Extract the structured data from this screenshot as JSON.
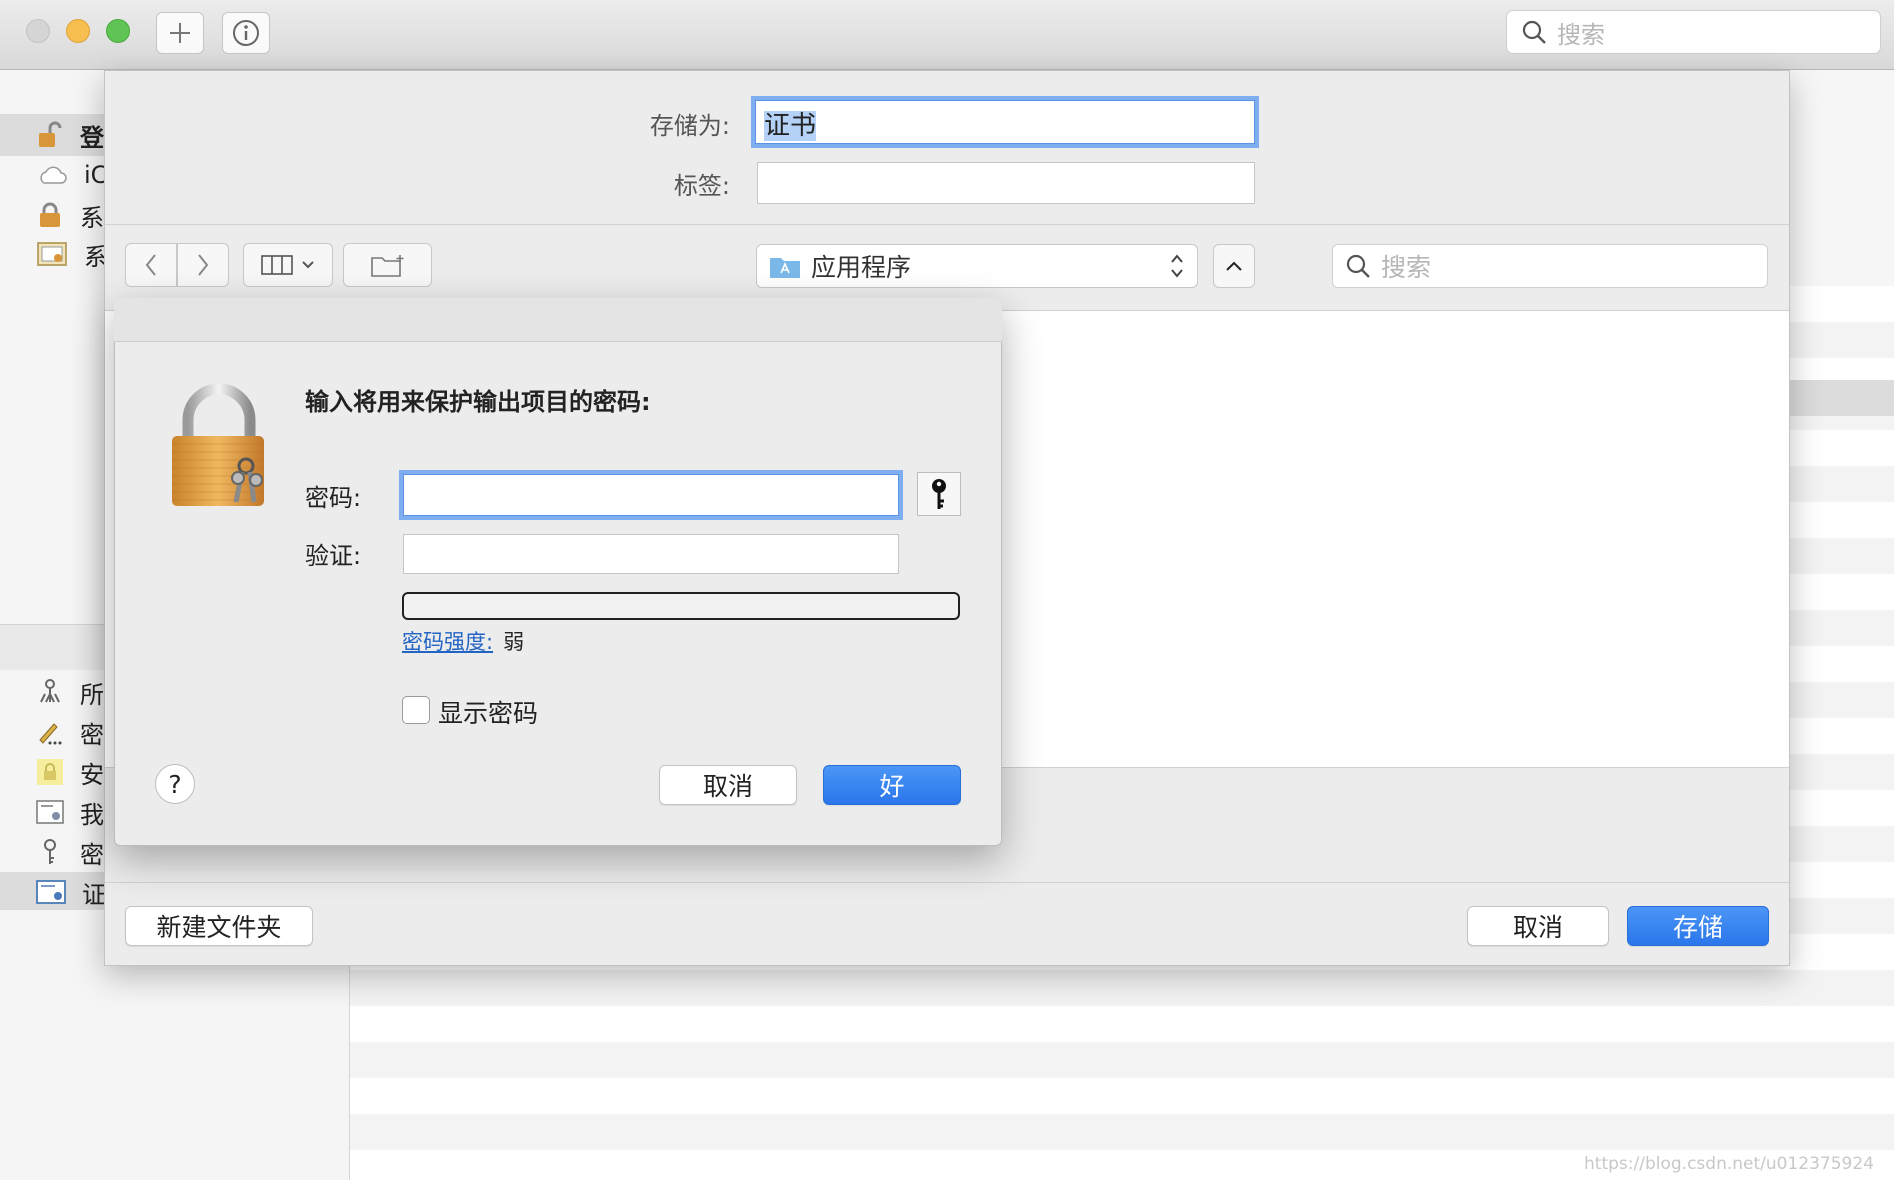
{
  "window": {
    "search_placeholder": "搜索",
    "sidebar_keychains": [
      {
        "label": "登",
        "icon": "unlocked-padlock-icon"
      },
      {
        "label": "iC",
        "icon": "cloud-icon"
      },
      {
        "label": "系",
        "icon": "padlock-icon"
      },
      {
        "label": "系",
        "icon": "certificate-cabinet-icon"
      }
    ],
    "sidebar_categories": [
      {
        "label": "所",
        "icon": "keychain-access-icon"
      },
      {
        "label": "密",
        "icon": "pen-password-icon"
      },
      {
        "label": "安",
        "icon": "secure-note-icon"
      },
      {
        "label": "我",
        "icon": "my-certificate-icon"
      },
      {
        "label": "密",
        "icon": "key-icon"
      },
      {
        "label": "证",
        "icon": "certificate-icon"
      }
    ]
  },
  "save_sheet": {
    "save_as_label": "存储为:",
    "save_as_value": "证书",
    "tags_label": "标签:",
    "tags_value": "",
    "location": "应用程序",
    "search_placeholder": "搜索",
    "new_folder_label": "新建文件夹",
    "cancel_label": "取消",
    "save_label": "存储"
  },
  "password_dialog": {
    "prompt": "输入将用来保护输出项目的密码:",
    "password_label": "密码:",
    "password_value": "",
    "verify_label": "验证:",
    "verify_value": "",
    "strength_link": "密码强度:",
    "strength_value": "弱",
    "show_password_label": "显示密码",
    "help_label": "?",
    "cancel_label": "取消",
    "ok_label": "好"
  },
  "watermark": "https://blog.csdn.net/u012375924",
  "colors": {
    "accent": "#2a76eb",
    "focus_ring": "#7eaef0",
    "link": "#2264c4"
  }
}
